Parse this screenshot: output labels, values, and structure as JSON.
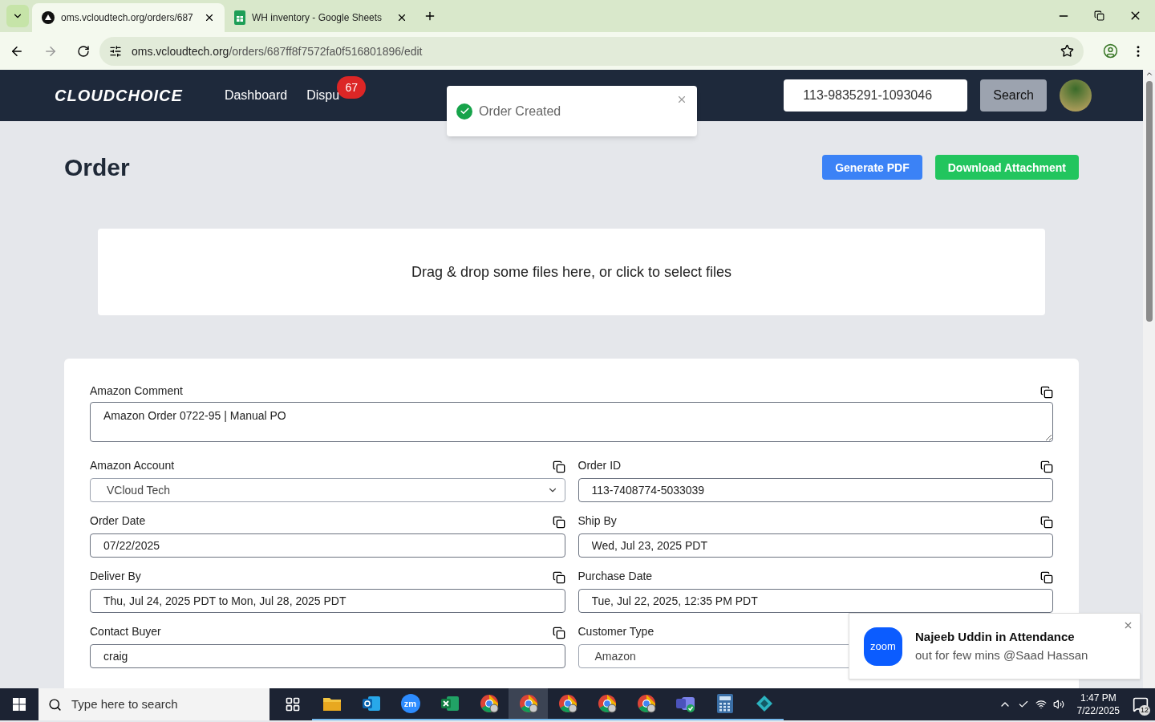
{
  "browser": {
    "tabs": [
      {
        "title": "oms.vcloudtech.org/orders/687",
        "selected": true,
        "kind": "triangle"
      },
      {
        "title": "WH inventory - Google Sheets",
        "selected": false,
        "kind": "sheets"
      }
    ],
    "url_host": "oms.vcloudtech.org",
    "url_path": "/orders/687ff8f7572fa0f516801896/edit"
  },
  "header": {
    "logo": "CLOUDCHOICE",
    "nav": [
      {
        "label": "Dashboard"
      },
      {
        "label": "Dispu",
        "badge": "67"
      }
    ],
    "search_value": "113-9835291-1093046",
    "search_button": "Search"
  },
  "toast": {
    "text": "Order Created"
  },
  "page": {
    "title": "Order",
    "buttons": [
      {
        "label": "Generate PDF",
        "color": "#3b82f6"
      },
      {
        "label": "Download Attachment",
        "color": "#22c55e"
      }
    ],
    "dropzone": "Drag & drop some files here, or click to select files"
  },
  "form": {
    "comment": {
      "label": "Amazon Comment",
      "value": "Amazon Order 0722-95 | Manual PO"
    },
    "fields": [
      {
        "label": "Amazon Account",
        "value": "VCloud Tech",
        "kind": "select"
      },
      {
        "label": "Order ID",
        "value": "113-7408774-5033039",
        "kind": "input"
      },
      {
        "label": "Order Date",
        "value": "07/22/2025",
        "kind": "input"
      },
      {
        "label": "Ship By",
        "value": "Wed, Jul 23, 2025 PDT",
        "kind": "input"
      },
      {
        "label": "Deliver By",
        "value": "Thu, Jul 24, 2025 PDT to Mon, Jul 28, 2025 PDT",
        "kind": "input"
      },
      {
        "label": "Purchase Date",
        "value": "Tue, Jul 22, 2025, 12:35 PM PDT",
        "kind": "input"
      },
      {
        "label": "Contact Buyer",
        "value": "craig",
        "kind": "input"
      },
      {
        "label": "Customer Type",
        "value": "Amazon",
        "kind": "select"
      }
    ]
  },
  "notification": {
    "logo": "zoom",
    "title": "Najeeb Uddin in Attendance",
    "body": "out for few mins @Saad Hassan"
  },
  "taskbar": {
    "search_placeholder": "Type here to search",
    "apps": [
      {
        "kind": "taskview",
        "selected": false
      },
      {
        "kind": "folder",
        "selected": false
      },
      {
        "kind": "outlook",
        "selected": false
      },
      {
        "kind": "zoom",
        "label": "zm",
        "selected": false
      },
      {
        "kind": "excel",
        "selected": false
      },
      {
        "kind": "chrome",
        "selected": false
      },
      {
        "kind": "chrome",
        "selected": true
      },
      {
        "kind": "chrome",
        "selected": false
      },
      {
        "kind": "chrome",
        "selected": false
      },
      {
        "kind": "chrome",
        "selected": false
      },
      {
        "kind": "teams",
        "selected": false
      },
      {
        "kind": "calculator",
        "selected": false
      },
      {
        "kind": "diamond",
        "selected": false
      }
    ],
    "time": "1:47 PM",
    "date": "7/22/2025",
    "notifications": "12"
  }
}
